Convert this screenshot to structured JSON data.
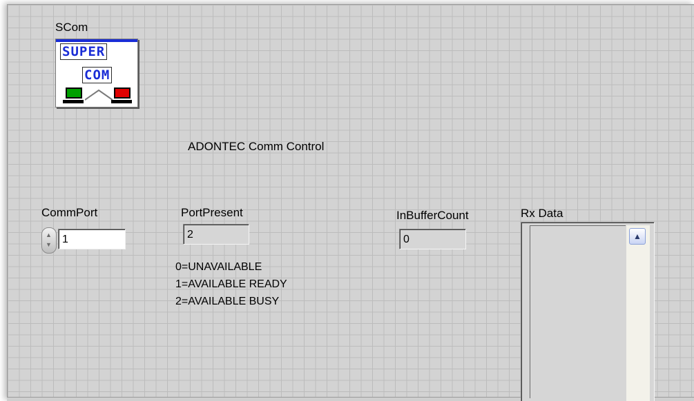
{
  "icon": {
    "title": "SCom",
    "line1": "SUPER",
    "line2": "COM"
  },
  "heading": "ADONTEC Comm Control",
  "commport": {
    "label": "CommPort",
    "value": "1",
    "increment_symbol": "▲",
    "decrement_symbol": "▼"
  },
  "portpresent": {
    "label": "PortPresent",
    "value": "2",
    "legend": [
      "0=UNAVAILABLE",
      "1=AVAILABLE READY",
      "2=AVAILABLE BUSY"
    ]
  },
  "inbuffer": {
    "label": "InBufferCount",
    "value": "0"
  },
  "rx": {
    "label": "Rx Data",
    "value": "",
    "scroll_up_symbol": "▲"
  },
  "colors": {
    "panel_bg": "#d3d3d3",
    "grid": "#bcbcbc",
    "icon_text": "#1a2dd6",
    "pc_left": "#00a000",
    "pc_right": "#e00000"
  }
}
